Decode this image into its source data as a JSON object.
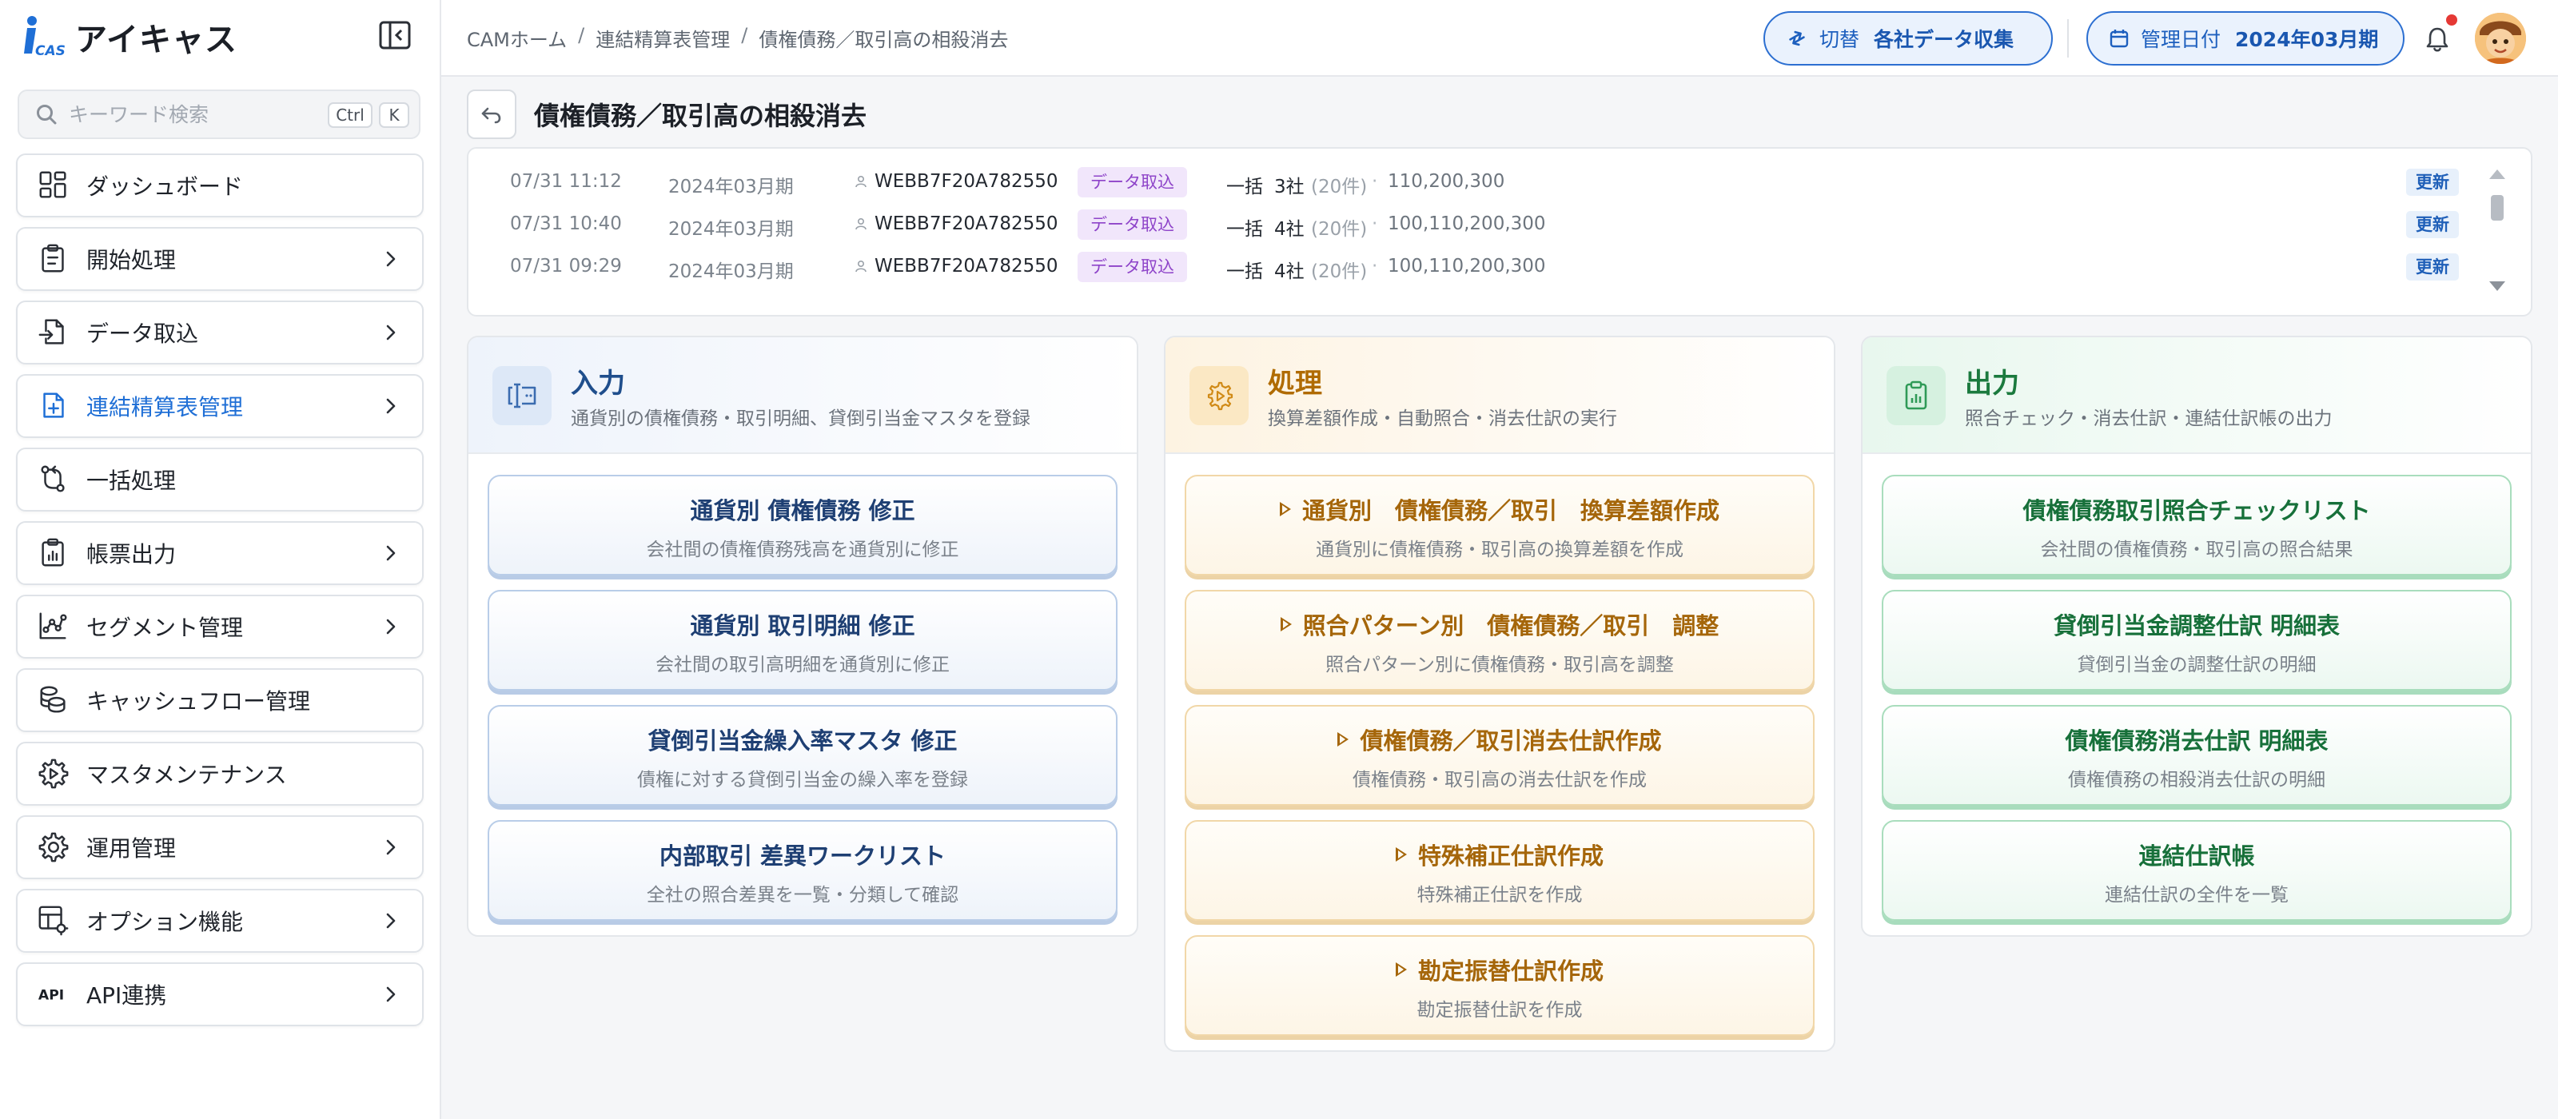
{
  "app": {
    "name": "アイキャス",
    "logo_text": "CAS"
  },
  "search": {
    "placeholder": "キーワード検索",
    "shortcut_ctrl": "Ctrl",
    "shortcut_key": "K"
  },
  "sidebar": {
    "items": [
      {
        "label": "ダッシュボード",
        "icon": "dashboard-icon",
        "has_chevron": false,
        "active": false
      },
      {
        "label": "開始処理",
        "icon": "clipboard-icon",
        "has_chevron": true,
        "active": false
      },
      {
        "label": "データ取込",
        "icon": "file-import-icon",
        "has_chevron": true,
        "active": false
      },
      {
        "label": "連結精算表管理",
        "icon": "file-plus-icon",
        "has_chevron": true,
        "active": true
      },
      {
        "label": "一括処理",
        "icon": "batch-icon",
        "has_chevron": false,
        "active": false
      },
      {
        "label": "帳票出力",
        "icon": "report-icon",
        "has_chevron": true,
        "active": false
      },
      {
        "label": "セグメント管理",
        "icon": "segment-chart-icon",
        "has_chevron": true,
        "active": false
      },
      {
        "label": "キャッシュフロー管理",
        "icon": "coins-icon",
        "has_chevron": false,
        "active": false
      },
      {
        "label": "マスタメンテナンス",
        "icon": "gear-play-icon",
        "has_chevron": false,
        "active": false
      },
      {
        "label": "運用管理",
        "icon": "gear-icon",
        "has_chevron": true,
        "active": false
      },
      {
        "label": "オプション機能",
        "icon": "grid-gear-icon",
        "has_chevron": true,
        "active": false
      },
      {
        "label": "API連携",
        "icon": "api-icon",
        "has_chevron": true,
        "active": false
      }
    ]
  },
  "header": {
    "breadcrumb": [
      "CAMホーム",
      "連結精算表管理",
      "債権債務／取引高の相殺消去"
    ],
    "switch_label": "切替",
    "switch_value": "各社データ収集",
    "date_label": "管理日付",
    "date_value": "2024年03月期"
  },
  "page": {
    "title": "債権債務／取引高の相殺消去"
  },
  "log": {
    "rows": [
      {
        "time": "07/31 11:12",
        "period": "2024年03月期",
        "user": "WEBB7F20A782550",
        "badge": "データ取込",
        "mode": "一括",
        "companies": "3社",
        "count": "(20件)",
        "amount": "110,200,300",
        "action": "更新"
      },
      {
        "time": "07/31 10:40",
        "period": "2024年03月期",
        "user": "WEBB7F20A782550",
        "badge": "データ取込",
        "mode": "一括",
        "companies": "4社",
        "count": "(20件)",
        "amount": "100,110,200,300",
        "action": "更新"
      },
      {
        "time": "07/31 09:29",
        "period": "2024年03月期",
        "user": "WEBB7F20A782550",
        "badge": "データ取込",
        "mode": "一括",
        "companies": "4社",
        "count": "(20件)",
        "amount": "100,110,200,300",
        "action": "更新"
      }
    ]
  },
  "columns": {
    "input": {
      "title": "入力",
      "subtitle": "通貨別の債権債務・取引明細、貸倒引当金マスタを登録",
      "cards": [
        {
          "title": "通貨別 債権債務 修正",
          "desc": "会社間の債権債務残高を通貨別に修正"
        },
        {
          "title": "通貨別 取引明細 修正",
          "desc": "会社間の取引高明細を通貨別に修正"
        },
        {
          "title": "貸倒引当金繰入率マスタ 修正",
          "desc": "債権に対する貸倒引当金の繰入率を登録"
        },
        {
          "title": "内部取引 差異ワークリスト",
          "desc": "全社の照合差異を一覧・分類して確認"
        }
      ]
    },
    "process": {
      "title": "処理",
      "subtitle": "換算差額作成・自動照合・消去仕訳の実行",
      "cards": [
        {
          "title": "通貨別　債権債務／取引　換算差額作成",
          "desc": "通貨別に債権債務・取引高の換算差額を作成"
        },
        {
          "title": "照合パターン別　債権債務／取引　調整",
          "desc": "照合パターン別に債権債務・取引高を調整"
        },
        {
          "title": "債権債務／取引消去仕訳作成",
          "desc": "債権債務・取引高の消去仕訳を作成"
        },
        {
          "title": "特殊補正仕訳作成",
          "desc": "特殊補正仕訳を作成"
        },
        {
          "title": "勘定振替仕訳作成",
          "desc": "勘定振替仕訳を作成"
        }
      ]
    },
    "output": {
      "title": "出力",
      "subtitle": "照合チェック・消去仕訳・連結仕訳帳の出力",
      "cards": [
        {
          "title": "債権債務取引照合チェックリスト",
          "desc": "会社間の債権債務・取引高の照合結果"
        },
        {
          "title": "貸倒引当金調整仕訳 明細表",
          "desc": "貸倒引当金の調整仕訳の明細"
        },
        {
          "title": "債権債務消去仕訳 明細表",
          "desc": "債権債務の相殺消去仕訳の明細"
        },
        {
          "title": "連結仕訳帳",
          "desc": "連結仕訳の全件を一覧"
        }
      ]
    }
  },
  "colors": {
    "primary": "#1f6fd6",
    "input_accent": "#1f4e8c",
    "process_accent": "#b06b00",
    "output_accent": "#1b7a3e",
    "badge_purple": "#8e44c9",
    "notification": "#e53935"
  }
}
